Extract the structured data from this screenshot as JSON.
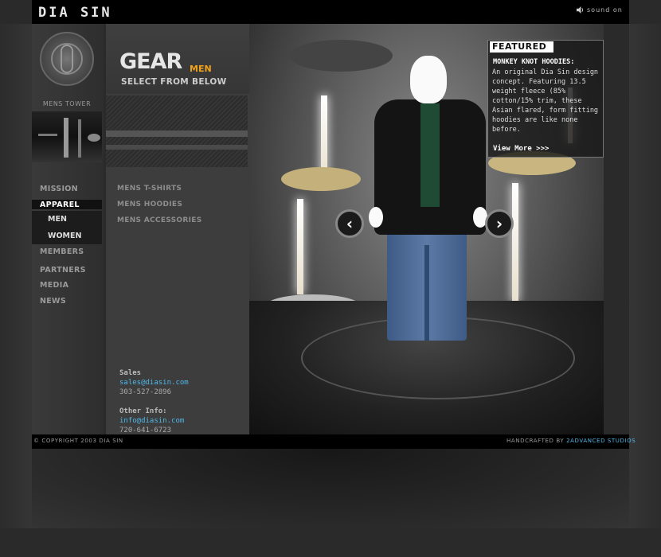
{
  "header": {
    "logo": "DIA SIN",
    "sound_label": "sound on"
  },
  "left_nav": {
    "tower_label": "MENS TOWER",
    "items": [
      "MISSION",
      "APPAREL",
      "MEMBERS",
      "PARTNERS",
      "MEDIA",
      "NEWS"
    ],
    "subitems": [
      "MEN",
      "WOMEN"
    ]
  },
  "gear": {
    "title": "GEAR",
    "subtitle": "MEN",
    "instruction": "SELECT FROM BELOW"
  },
  "categories": [
    "MENS T-SHIRTS",
    "MENS HOODIES",
    "MENS ACCESSORIES"
  ],
  "contacts": {
    "sales_label": "Sales",
    "sales_email": "sales@diasin.com",
    "sales_phone": "303-527-2896",
    "other_label": "Other Info:",
    "info_email": "info@diasin.com",
    "info_phone": "720-641-6723"
  },
  "featured": {
    "tag": "FEATURED",
    "title": "MONKEY KNOT HOODIES:",
    "body": "An original Dia Sin design concept.  Featuring 13.5 weight fleece (85% cotton/15% trim, these Asian flared, form fitting hoodies are like none before.",
    "link": "View More >>>"
  },
  "footer": {
    "copyright": "© COPYRIGHT 2003 DIA SIN",
    "credit_prefix": "HANDCRAFTED BY",
    "credit_brand": "2ADVANCED STUDIOS"
  },
  "colors": {
    "accent_orange": "#f0a21a",
    "link_blue": "#4fb8e8",
    "background": "#2b2b2b"
  },
  "icons": [
    "speaker-icon",
    "arrow-left-icon",
    "arrow-right-icon",
    "emblem-logo"
  ]
}
